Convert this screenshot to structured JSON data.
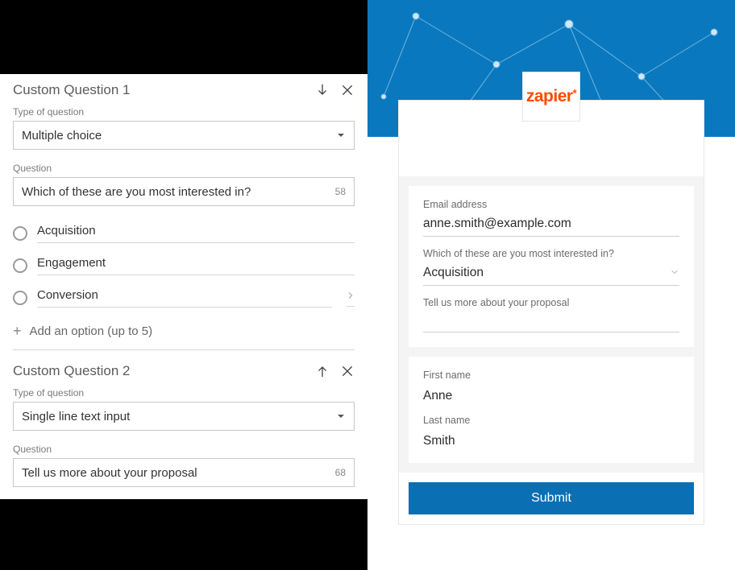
{
  "builder": {
    "q1": {
      "title": "Custom Question 1",
      "type_label": "Type of question",
      "type_value": "Multiple choice",
      "question_label": "Question",
      "question_value": "Which of these are you most interested in?",
      "char_counter": "58",
      "options": [
        "Acquisition",
        "Engagement",
        "Conversion"
      ],
      "add_option": "Add an option (up to 5)"
    },
    "q2": {
      "title": "Custom Question 2",
      "type_label": "Type of question",
      "type_value": "Single line text input",
      "question_label": "Question",
      "question_value": "Tell us more about your proposal",
      "char_counter": "68"
    }
  },
  "preview": {
    "logo_text": "zapier",
    "email_label": "Email address",
    "email_value": "anne.smith@example.com",
    "mc_label": "Which of these are you most interested in?",
    "mc_value": "Acquisition",
    "text_label": "Tell us more about your proposal",
    "first_name_label": "First name",
    "first_name_value": "Anne",
    "last_name_label": "Last name",
    "last_name_value": "Smith",
    "submit": "Submit"
  }
}
